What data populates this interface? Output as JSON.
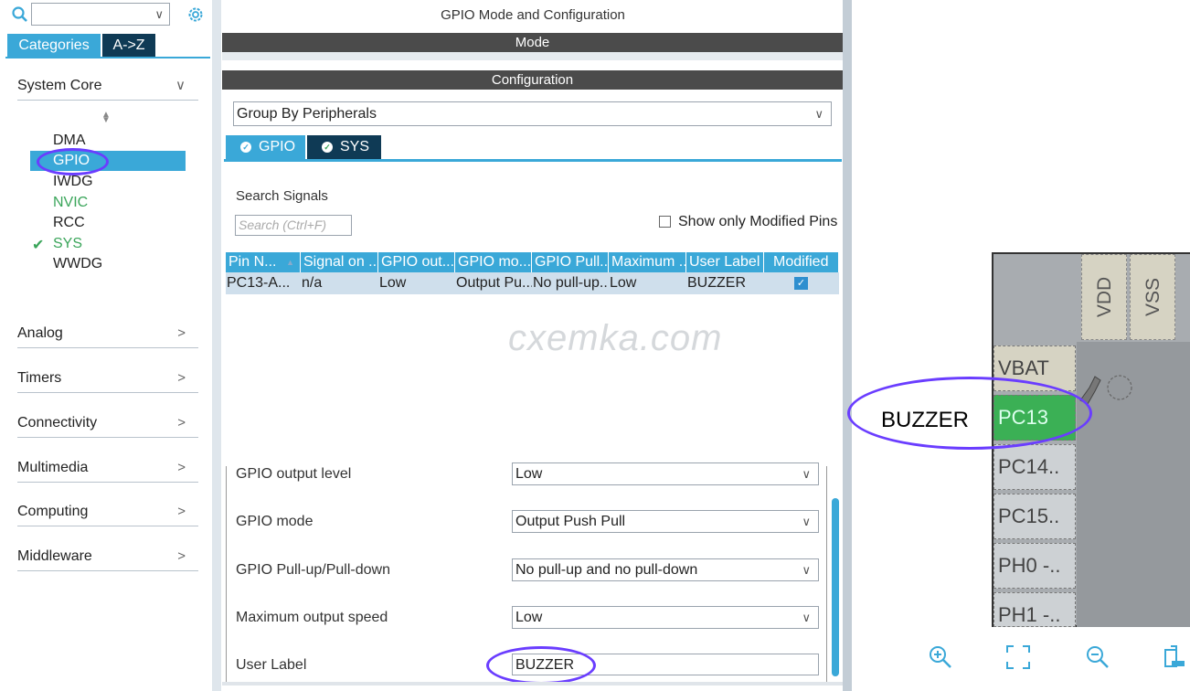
{
  "left_panel": {
    "tabs": {
      "categories": "Categories",
      "az": "A->Z"
    },
    "system_core": {
      "label": "System Core",
      "items": [
        "DMA",
        "GPIO",
        "IWDG",
        "NVIC",
        "RCC",
        "SYS",
        "WWDG"
      ]
    },
    "categories": [
      "Analog",
      "Timers",
      "Connectivity",
      "Multimedia",
      "Computing",
      "Middleware"
    ]
  },
  "center": {
    "title": "GPIO Mode and Configuration",
    "mode_bar": "Mode",
    "config_bar": "Configuration",
    "group_by": "Group By Peripherals",
    "tabs": [
      "GPIO",
      "SYS"
    ],
    "search_label": "Search Signals",
    "search_placeholder": "Search (Ctrl+F)",
    "show_modified": "Show only Modified Pins",
    "table": {
      "headers": [
        "Pin N...",
        "Signal on ...",
        "GPIO out...",
        "GPIO mo...",
        "GPIO Pull...",
        "Maximum ...",
        "User Label",
        "Modified"
      ],
      "row": [
        "PC13-A...",
        "n/a",
        "Low",
        "Output Pu...",
        "No pull-up...",
        "Low",
        "BUZZER"
      ]
    },
    "watermark": "cxemka.com",
    "properties": [
      {
        "label": "GPIO output level",
        "value": "Low"
      },
      {
        "label": "GPIO mode",
        "value": "Output Push Pull"
      },
      {
        "label": "GPIO Pull-up/Pull-down",
        "value": "No pull-up and no pull-down"
      },
      {
        "label": "Maximum output speed",
        "value": "Low"
      },
      {
        "label": "User Label",
        "value": "BUZZER"
      }
    ]
  },
  "right": {
    "pins_top": [
      "VDD",
      "VSS"
    ],
    "pins_left": [
      "VBAT",
      "PC13",
      "PC14..",
      "PC15..",
      "PH0 -..",
      "PH1 -.."
    ],
    "pin_label": "BUZZER"
  },
  "colors": {
    "accent": "#3aa8d8",
    "dark_tab": "#0f3a55",
    "annotation": "#6a3dff",
    "pin_active": "#3bb055"
  }
}
